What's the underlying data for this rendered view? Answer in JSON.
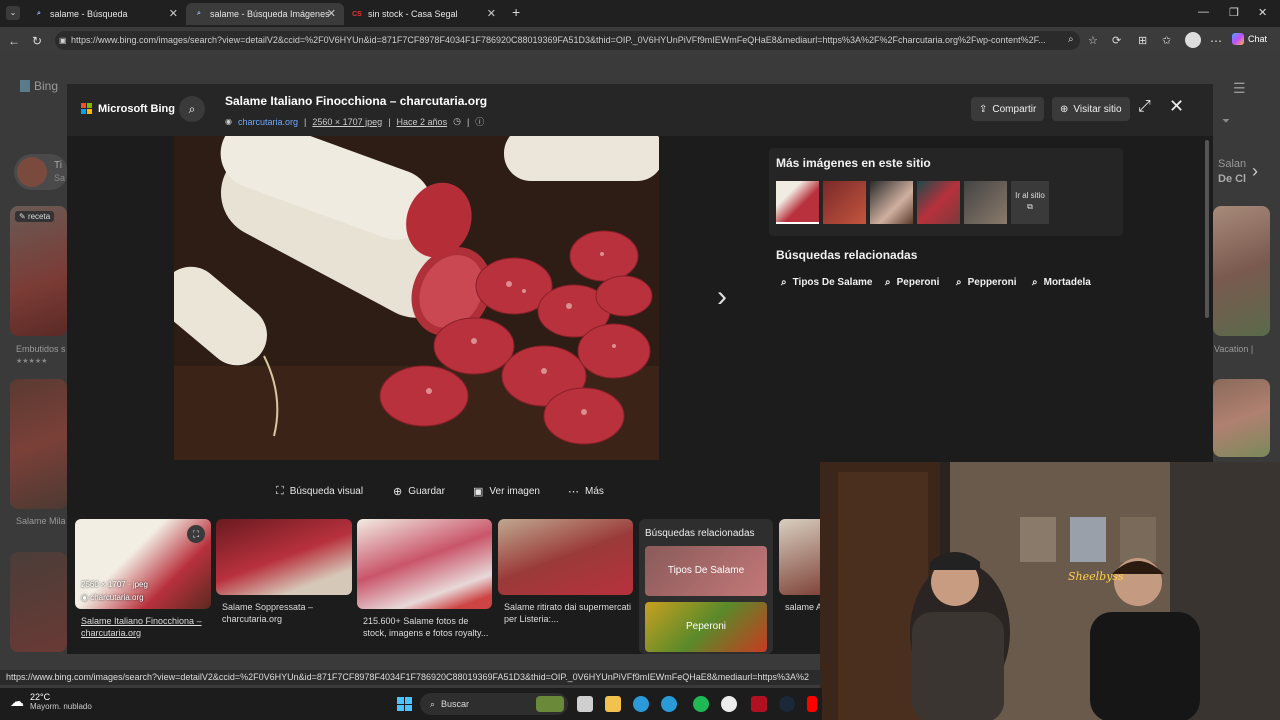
{
  "tabs": [
    {
      "label": "salame - Búsqueda",
      "active": false
    },
    {
      "label": "salame - Búsqueda Imágenes",
      "active": true
    },
    {
      "label": "sin stock - Casa Segal",
      "active": false,
      "fav_text": "CS"
    }
  ],
  "address": {
    "url": "https://www.bing.com/images/search?view=detailV2&ccid=%2F0V6HYUn&id=871F7CF8978F4034F1F786920C88019369FA51D3&thid=OIP._0V6HYUnPiVFf9mIEWmFeQHaE8&mediaurl=https%3A%2F%2Fcharcutaria.org%2Fwp-content%2F...",
    "chat_label": "Chat"
  },
  "background": {
    "bing_label": "Bing",
    "left_card_title": "Ti",
    "left_card_sub": "Sa",
    "receta_badge": "receta",
    "emb_caption": "Embutidos s",
    "salame_caption": "Salame Mila",
    "right_top_line1": "Salan",
    "right_top_line2": "De Cl",
    "right_caption": "Vacation |",
    "stars": "★★★★★"
  },
  "modal": {
    "brand": "Microsoft Bing",
    "title": "Salame Italiano Finocchiona – charcutaria.org",
    "source": "charcutaria.org",
    "dimensions": "2560 × 1707 jpeg",
    "age": "Hace 2 años",
    "share_label": "Compartir",
    "visit_label": "Visitar sitio",
    "actions": {
      "visual_search": "Búsqueda visual",
      "save": "Guardar",
      "view_image": "Ver imagen",
      "more": "Más"
    },
    "more_images_heading": "Más imágenes en este sitio",
    "go_to_site": "Ir al sitio",
    "related_heading": "Búsquedas relacionadas",
    "related": [
      "Tipos De Salame",
      "Peperoni",
      "Pepperoni",
      "Mortadela"
    ],
    "results": [
      {
        "caption": "Salame Italiano Finocchiona – charcutaria.org",
        "overlay_dims": "2560 × 1707 · jpeg",
        "overlay_source": "charcutaria.org"
      },
      {
        "caption": "Salame Soppressata – charcutaria.org"
      },
      {
        "caption": "215.600+ Salame fotos de stock, imagens e fotos royalty..."
      },
      {
        "caption": "Salame ritirato dai supermercati per Listeria:..."
      }
    ],
    "related_panel": {
      "heading": "Búsquedas relacionadas",
      "items": [
        "Tipos De Salame",
        "Peperoni"
      ]
    },
    "cut_caption": "salame A"
  },
  "status_url": "https://www.bing.com/images/search?view=detailV2&ccid=%2F0V6HYUn&id=871F7CF8978F4034F1F786920C88019369FA51D3&thid=OIP._0V6HYUnPiVFf9mIEWmFeQHaE8&mediaurl=https%3A%2",
  "taskbar": {
    "temp": "22°C",
    "weather": "Mayorm. nublado",
    "search_placeholder": "Buscar"
  },
  "webcam": {
    "neon_sign": "Sheelbyss"
  }
}
